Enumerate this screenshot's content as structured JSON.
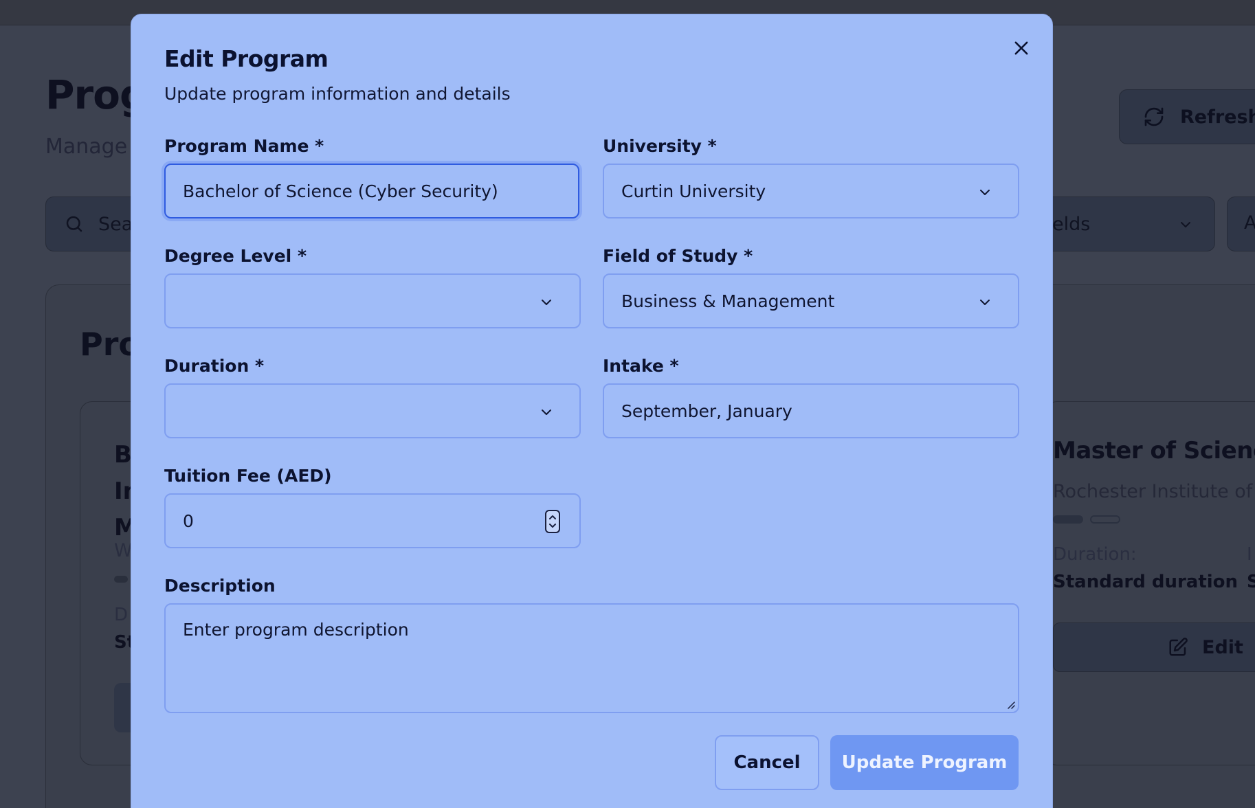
{
  "background": {
    "page_title": "Prog",
    "page_subtitle": "Manage",
    "refresh_label": "Refresh",
    "search_placeholder": "Sea",
    "filter_label": "elds",
    "filter2_label": "A",
    "panel_title": "Pro",
    "left_card": {
      "title_lines": [
        "B",
        "In",
        "M"
      ],
      "sub": "W",
      "duration_label": "D",
      "duration_value": "St"
    },
    "right_card": {
      "title": "Master of Science in",
      "university": "Rochester Institute of Te",
      "duration_label": "Duration:",
      "duration_value": "Standard duration",
      "intake_label": "I",
      "intake_value": "S",
      "edit_label": "Edit"
    }
  },
  "modal": {
    "title": "Edit Program",
    "subtitle": "Update program information and details",
    "fields": {
      "program_name": {
        "label": "Program Name *",
        "value": "Bachelor of Science (Cyber Security)"
      },
      "university": {
        "label": "University *",
        "value": "Curtin University"
      },
      "degree_level": {
        "label": "Degree Level *",
        "value": ""
      },
      "field_of_study": {
        "label": "Field of Study *",
        "value": "Business & Management"
      },
      "duration": {
        "label": "Duration *",
        "value": ""
      },
      "intake": {
        "label": "Intake *",
        "value": "September, January"
      },
      "tuition_fee": {
        "label": "Tuition Fee (AED)",
        "value": "0"
      },
      "description": {
        "label": "Description",
        "placeholder": "Enter program description"
      }
    },
    "buttons": {
      "cancel": "Cancel",
      "update": "Update Program"
    }
  },
  "colors": {
    "modal_bg": "#a0bcf8",
    "primary_button": "#6f97f2",
    "focus_ring": "#2f5be0"
  }
}
